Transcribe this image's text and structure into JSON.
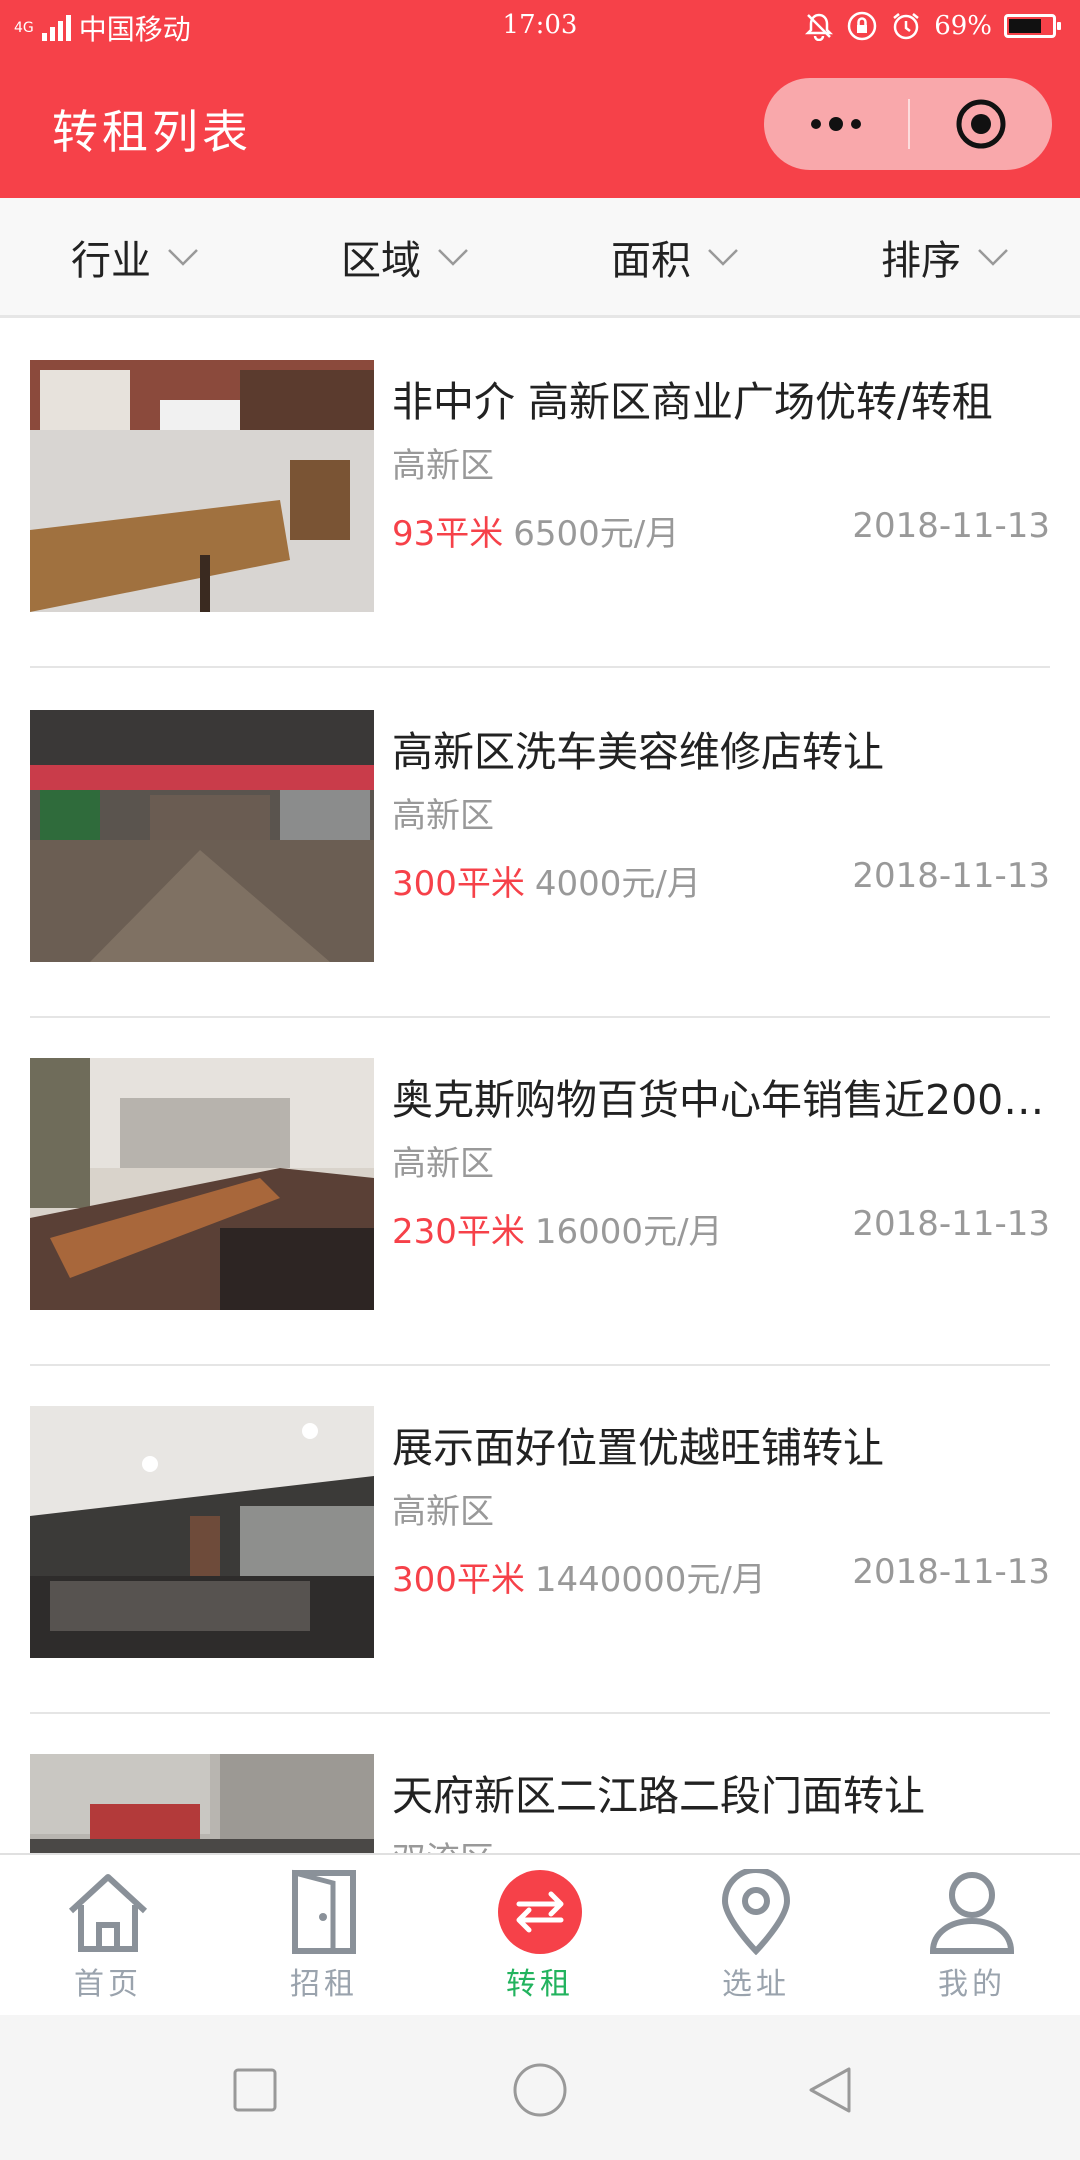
{
  "status_bar": {
    "network": "4G",
    "carrier": "中国移动",
    "time": "17:03",
    "battery": "69%",
    "battery_level": 0.69
  },
  "header": {
    "title": "转租列表",
    "accent_color": "#f64149"
  },
  "filters": [
    {
      "label": "行业"
    },
    {
      "label": "区域"
    },
    {
      "label": "面积"
    },
    {
      "label": "排序"
    }
  ],
  "listings": [
    {
      "title": "非中介 高新区商业广场优转/转租",
      "district": "高新区",
      "area": "93平米",
      "rent": "6500元/月",
      "date": "2018-11-13"
    },
    {
      "title": "高新区洗车美容维修店转让",
      "district": "高新区",
      "area": "300平米",
      "rent": "4000元/月",
      "date": "2018-11-13"
    },
    {
      "title": "奥克斯购物百货中心年销售近200…",
      "district": "高新区",
      "area": "230平米",
      "rent": "16000元/月",
      "date": "2018-11-13"
    },
    {
      "title": "展示面好位置优越旺铺转让",
      "district": "高新区",
      "area": "300平米",
      "rent": "1440000元/月",
      "date": "2018-11-13"
    },
    {
      "title": "天府新区二江路二段门面转让",
      "district": "双流区",
      "area": "",
      "rent": "",
      "date": ""
    }
  ],
  "tab_bar": {
    "tabs": [
      {
        "label": "首页",
        "icon": "home-icon"
      },
      {
        "label": "招租",
        "icon": "door-icon"
      },
      {
        "label": "转租",
        "icon": "swap-icon",
        "active": true
      },
      {
        "label": "选址",
        "icon": "location-pin-icon"
      },
      {
        "label": "我的",
        "icon": "user-icon"
      }
    ],
    "active_color": "#22b35e",
    "inactive_color": "#9aa3ad"
  }
}
